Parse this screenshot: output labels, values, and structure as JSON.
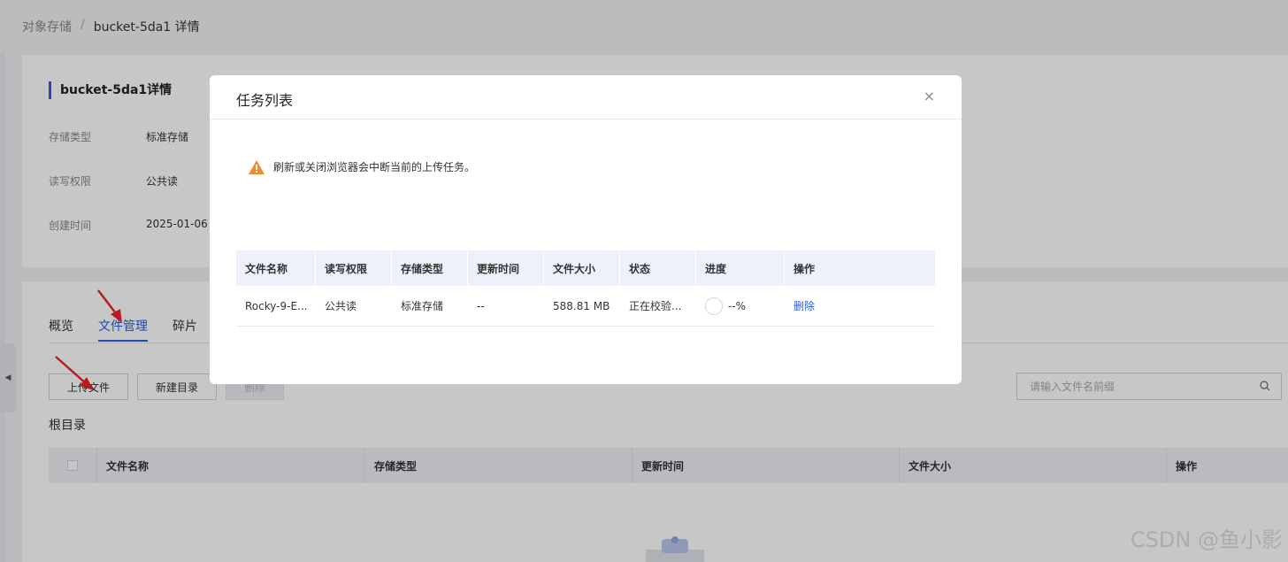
{
  "breadcrumb": {
    "root": "对象存储",
    "separator": "/",
    "current": "bucket-5da1 详情"
  },
  "info": {
    "title": "bucket-5da1详情",
    "rows": [
      {
        "key": "存储类型",
        "value": "标准存储"
      },
      {
        "key": "读写权限",
        "value": "公共读"
      },
      {
        "key": "创建时间",
        "value": "2025-01-06"
      }
    ]
  },
  "tabs": [
    "概览",
    "文件管理",
    "碎片"
  ],
  "toolbar": {
    "upload": "上传文件",
    "new_dir": "新建目录",
    "delete": "删除",
    "search_placeholder": "请输入文件名前缀"
  },
  "root_dir": "根目录",
  "file_table": {
    "columns": [
      "文件名称",
      "存储类型",
      "更新时间",
      "文件大小",
      "操作"
    ]
  },
  "modal": {
    "title": "任务列表",
    "close": "×",
    "warning": "刷新或关闭浏览器会中断当前的上传任务。",
    "columns": [
      "文件名称",
      "读写权限",
      "存储类型",
      "更新时间",
      "文件大小",
      "状态",
      "进度",
      "操作"
    ],
    "rows": [
      {
        "name": "Rocky-9-E...",
        "acl": "公共读",
        "storage": "标准存储",
        "updated": "--",
        "size": "588.81 MB",
        "status": "正在校验...",
        "progress": "--%",
        "action": "删除"
      }
    ]
  },
  "watermark": "CSDN @鱼小影",
  "colors": {
    "accent": "#2b5fd9",
    "warning": "#f08c2e",
    "arrow": "#e8262b"
  }
}
